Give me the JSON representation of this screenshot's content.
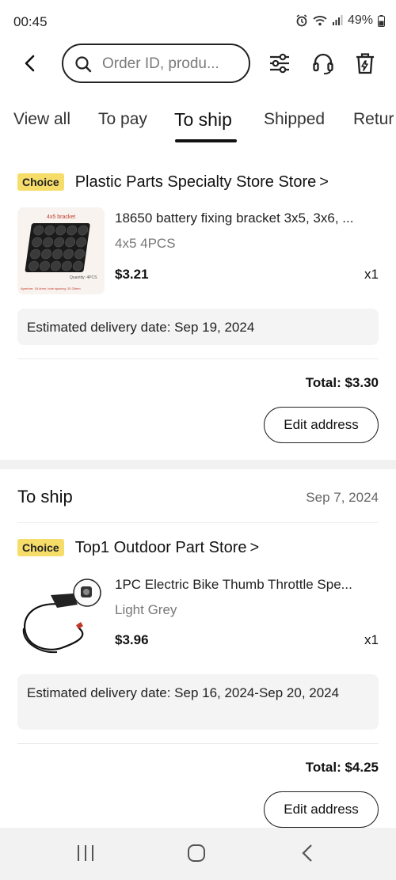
{
  "status_bar": {
    "time": "00:45",
    "battery": "49%",
    "icons": [
      "alarm-icon",
      "wifi-icon",
      "signal-icon",
      "battery-icon"
    ]
  },
  "header": {
    "search_placeholder": "Order ID, produ...",
    "icons": [
      "back-arrow-icon",
      "search-icon",
      "filter-sliders-icon",
      "headset-icon",
      "trash-icon"
    ]
  },
  "tabs": [
    {
      "label": "View all",
      "active": false
    },
    {
      "label": "To pay",
      "active": false
    },
    {
      "label": "To ship",
      "active": true
    },
    {
      "label": "Shipped",
      "active": false
    },
    {
      "label": "Retur",
      "active": false
    }
  ],
  "orders": [
    {
      "badge": "Choice",
      "store": "Plastic Parts Specialty Store Store",
      "store_chevron": ">",
      "image_caption": {
        "title": "4x5 bracket",
        "quantity": "Quantity: 4PCS",
        "spec": "Aperture: 18.4mm, hole spacing: 20.25mm"
      },
      "product_title": "18650 battery fixing bracket 3x5, 3x6, ...",
      "variant": "4x5  4PCS",
      "price": "$3.21",
      "quantity": "x1",
      "delivery": "Estimated delivery date: Sep 19, 2024",
      "total": "Total: $3.30",
      "edit_label": "Edit address"
    },
    {
      "status": "To ship",
      "date": "Sep 7, 2024",
      "badge": "Choice",
      "store": "Top1 Outdoor Part Store",
      "store_chevron": ">",
      "product_title": "1PC Electric Bike Thumb Throttle Spe...",
      "variant": "Light Grey",
      "price": "$3.96",
      "quantity": "x1",
      "delivery": "Estimated delivery date: Sep 16, 2024-Sep 20, 2024",
      "total": "Total: $4.25",
      "edit_label": "Edit address"
    }
  ],
  "nav_bar": {
    "icons": [
      "recents-icon",
      "home-icon",
      "back-icon"
    ]
  },
  "colors": {
    "choice_badge": "#f6dd6a",
    "active_tab": "#111111",
    "delivery_bg": "#f4f4f4"
  }
}
